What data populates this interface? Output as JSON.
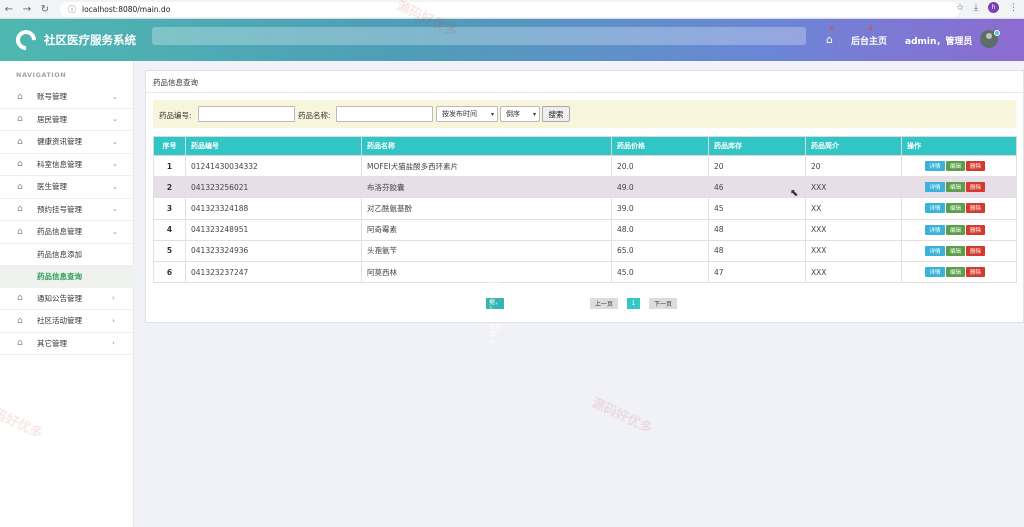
{
  "browser": {
    "url": "localhost:8080/main.do",
    "profile_initial": "h"
  },
  "header": {
    "app_title": "社区医疗服务系统",
    "backend_link": "后台主页",
    "user_text": "admin，管理员"
  },
  "sidebar": {
    "heading": "NAVIGATION",
    "items": [
      {
        "label": "账号管理",
        "chevron": "⌄"
      },
      {
        "label": "居民管理",
        "chevron": "⌄"
      },
      {
        "label": "健康资讯管理",
        "chevron": "⌄"
      },
      {
        "label": "科室信息管理",
        "chevron": "⌄"
      },
      {
        "label": "医生管理",
        "chevron": "⌄"
      },
      {
        "label": "预约挂号管理",
        "chevron": "⌄"
      },
      {
        "label": "药品信息管理",
        "chevron": "⌄"
      }
    ],
    "subitems": [
      {
        "label": "药品信息添加"
      },
      {
        "label": "药品信息查询"
      }
    ],
    "items_after": [
      {
        "label": "通知公告管理",
        "chevron": "›"
      },
      {
        "label": "社区活动管理",
        "chevron": "›"
      },
      {
        "label": "其它管理",
        "chevron": "›"
      }
    ]
  },
  "panel": {
    "title": "药品信息查询",
    "search": {
      "code_label": "药品编号:",
      "name_label": "药品名称:",
      "sort_field": "按发布时间",
      "sort_order": "倒序",
      "search_button": "搜索"
    },
    "table": {
      "headers": [
        "序号",
        "药品编号",
        "药品名称",
        "药品价格",
        "药品库存",
        "药品简介",
        "操作"
      ],
      "rows": [
        {
          "idx": "1",
          "code": "01241430034332",
          "name": "MOFEI犬猫盐酸多西环素片",
          "price": "20.0",
          "stock": "20",
          "intro": "20"
        },
        {
          "idx": "2",
          "code": "041323256021",
          "name": "布洛芬胶囊",
          "price": "49.0",
          "stock": "46",
          "intro": "XXX"
        },
        {
          "idx": "3",
          "code": "041323324188",
          "name": "对乙酰氨基酚",
          "price": "39.0",
          "stock": "45",
          "intro": "XX"
        },
        {
          "idx": "4",
          "code": "041323248951",
          "name": "阿奇霉素",
          "price": "48.0",
          "stock": "48",
          "intro": "XXX"
        },
        {
          "idx": "5",
          "code": "041323324936",
          "name": "头孢氨苄",
          "price": "65.0",
          "stock": "48",
          "intro": "XXX"
        },
        {
          "idx": "6",
          "code": "041323237247",
          "name": "阿莫西林",
          "price": "45.0",
          "stock": "47",
          "intro": "XXX"
        }
      ],
      "op_labels": {
        "detail": "详情",
        "edit": "编辑",
        "delete": "删除"
      }
    },
    "pager": {
      "info": "总计：6行数据，1页，每页10行",
      "prev": "上一页",
      "current": "1",
      "next": "下一页"
    }
  },
  "watermark": "源码好优多"
}
